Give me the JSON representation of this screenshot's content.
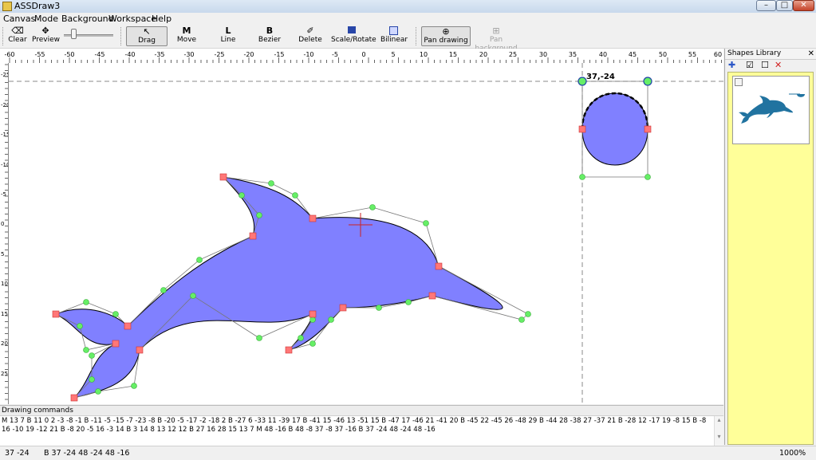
{
  "window": {
    "title": "ASSDraw3",
    "minimize": "–",
    "maximize": "□",
    "close": "✕"
  },
  "menu": [
    "Canvas",
    "Mode",
    "Background",
    "Workspace",
    "Help"
  ],
  "toolbar": {
    "clear": {
      "label": "Clear",
      "icon": "eraser-icon"
    },
    "preview": {
      "label": "Preview",
      "icon": "puzzle-icon"
    },
    "drag": {
      "label": "Drag",
      "icon": "cursor-icon"
    },
    "move": {
      "label": "Move",
      "icon": "M"
    },
    "line": {
      "label": "Line",
      "icon": "L"
    },
    "bezier": {
      "label": "Bezier",
      "icon": "B"
    },
    "delete": {
      "label": "Delete",
      "icon": "delete-point-icon"
    },
    "scale_rotate": {
      "label": "Scale/Rotate",
      "icon": "scale-rotate-icon"
    },
    "bilinear": {
      "label": "Bilinear",
      "icon": "bilinear-icon"
    },
    "pan_drawing": {
      "label": "Pan drawing",
      "icon": "pan-drawing-icon"
    },
    "pan_background": {
      "label": "Pan background",
      "icon": "pan-background-icon"
    }
  },
  "rulers": {
    "h_labels": [
      "-60",
      "-55",
      "-50",
      "-45",
      "-40",
      "-35",
      "-30",
      "-25",
      "-20",
      "-15",
      "-10",
      "-5",
      "0",
      "5",
      "10",
      "15",
      "20",
      "25",
      "30",
      "35",
      "40",
      "45",
      "50",
      "55",
      "60"
    ],
    "v_labels": [
      "-25",
      "-20",
      "-15",
      "-10",
      "-5",
      "0",
      "5",
      "10",
      "15",
      "20",
      "25"
    ]
  },
  "canvas": {
    "coord_label": "37,-24"
  },
  "drawing_commands": {
    "header": "Drawing commands",
    "text": "M 13 7 B 11 0 2 -3 -8 -1 B -11 -5 -15 -7 -23 -8 B -20 -5 -17 -2 -18 2 B -27 6 -33 11 -39 17 B -41 15 -46 13 -51 15 B -47 17 -46 21 -41 20 B -45 22 -45 26 -48 29 B -44 28 -38 27 -37 21 B -28 12 -17 19 -8 15 B -8 16 -10 19 -12 21 B -8 20 -5 16 -3 14 B 3 14 8 13 12 12 B 27 16 28 15 13 7 M 48 -16 B 48 -8 37 -8 37 -16 B 37 -24 48 -24 48 -16",
    "scroll_down": "▾",
    "scroll_up": "▴"
  },
  "status": {
    "coords": "37  -24",
    "info": "B 37 -24 48 -24 48 -16",
    "zoom": "1000%"
  },
  "library": {
    "title": "Shapes Library",
    "close": "✕",
    "add_icon": "✚",
    "check_all": "☑",
    "uncheck_all": "☐",
    "delete_icon": "✕"
  },
  "colors": {
    "shape_fill": "#8080ff",
    "accent_control": "#4d9de0",
    "library_bg": "#ffff99",
    "dolphin_thumb": "#2173a0"
  }
}
